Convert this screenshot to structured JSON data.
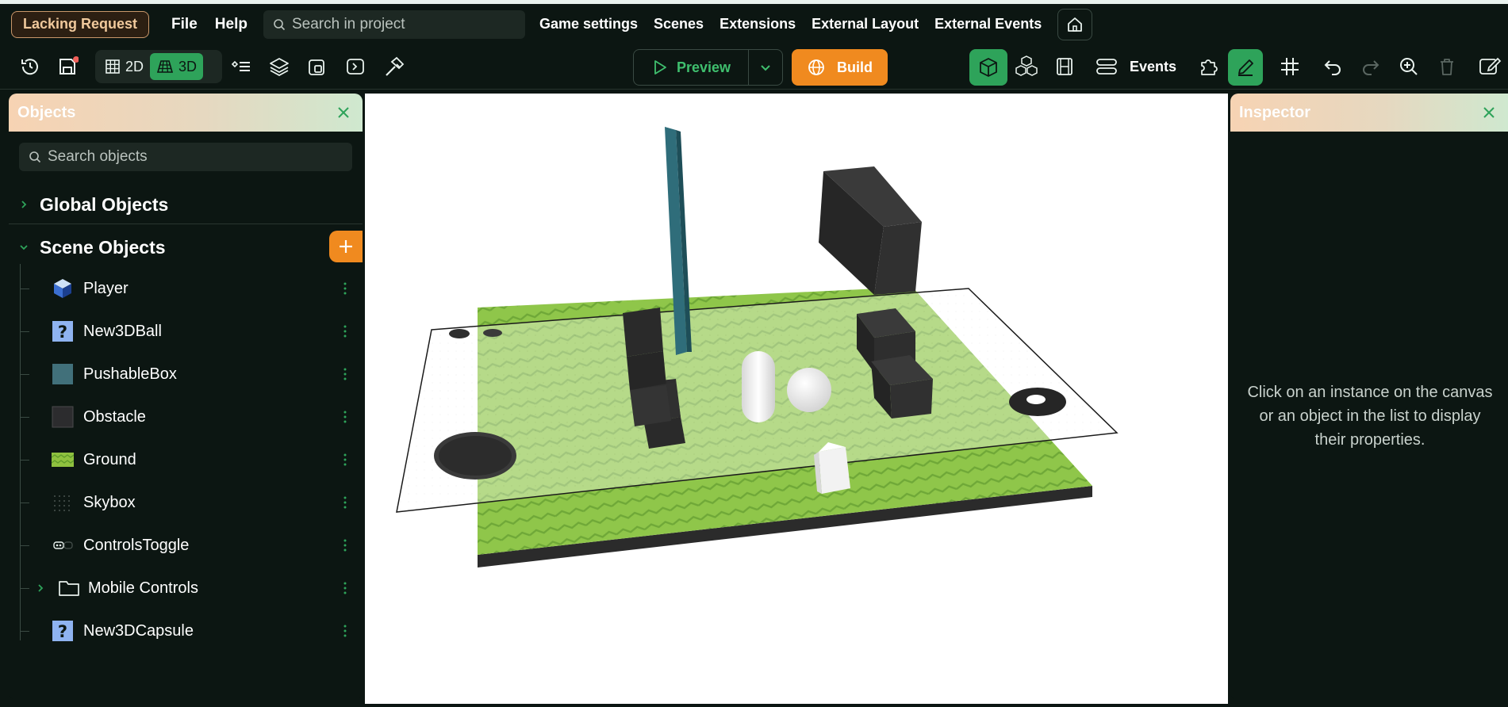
{
  "menubar": {
    "project_name": "Lacking Request",
    "file": "File",
    "help": "Help",
    "search_placeholder": "Search in project",
    "links": [
      "Game settings",
      "Scenes",
      "Extensions",
      "External Layout",
      "External Events"
    ]
  },
  "toolbar": {
    "mode_2d": "2D",
    "mode_3d": "3D",
    "active_mode": "3D",
    "preview": "Preview",
    "build": "Build",
    "events": "Events"
  },
  "objects_panel": {
    "title": "Objects",
    "search_placeholder": "Search objects",
    "global_section": "Global Objects",
    "scene_section": "Scene Objects",
    "items": [
      {
        "label": "Player",
        "icon": "cube-icon"
      },
      {
        "label": "New3DBall",
        "icon": "question-icon"
      },
      {
        "label": "PushableBox",
        "icon": "box-icon"
      },
      {
        "label": "Obstacle",
        "icon": "box-icon"
      },
      {
        "label": "Ground",
        "icon": "ground-icon"
      },
      {
        "label": "Skybox",
        "icon": "skybox-icon"
      },
      {
        "label": "ControlsToggle",
        "icon": "gamepad-icon"
      },
      {
        "label": "Mobile Controls",
        "icon": "folder-icon"
      },
      {
        "label": "New3DCapsule",
        "icon": "question-icon"
      }
    ]
  },
  "inspector": {
    "title": "Inspector",
    "empty_message": "Click on an instance on the canvas or an object in the list to display their properties."
  },
  "colors": {
    "accent_green": "#2ea35a",
    "accent_orange": "#f08a1f",
    "background": "#0c1612"
  }
}
